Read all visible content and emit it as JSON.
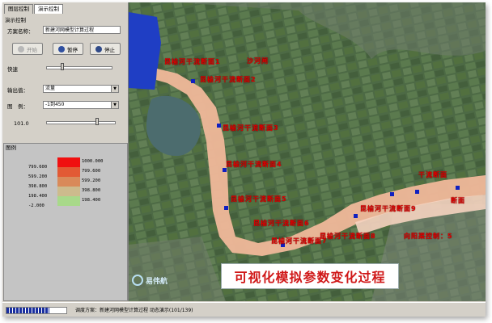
{
  "tabs": [
    "图层控制",
    "演示控制"
  ],
  "demo": {
    "group_title": "演示控制",
    "scheme_label": "方案名称：",
    "scheme_value": "新建河网模型计算过程",
    "buttons": {
      "start": "开始",
      "pause": "暂停",
      "stop": "停止"
    },
    "speed_label": "快速",
    "speed_level": 0.25,
    "output_label": "输出值：",
    "output_value": "流量",
    "legend_label": "图　例：",
    "legend_value": "-1到450",
    "value_label": "101.0",
    "value_level": 0.75
  },
  "legend": {
    "title": "图例",
    "upper_values": [
      "1000.000",
      "799.600",
      "599.200",
      "398.800",
      "198.400"
    ],
    "lower_values": [
      "799.600",
      "599.200",
      "398.800",
      "198.400",
      "-2.000"
    ],
    "colors": [
      "#f01010",
      "#e25a35",
      "#d98a5a",
      "#cdbb8d",
      "#a8d98a"
    ]
  },
  "map": {
    "section_labels": [
      "昆榆河干流断面1",
      "沙河闸",
      "昆榆河干流断面2",
      "昆榆河干流断面3",
      "昆榆河干流断面4",
      "昆榆河干流断面5",
      "昆榆河干流断面6",
      "昆榆河干流断面7",
      "昆榆河干流断面8",
      "昆榆河干流断面9",
      "向阳渠控制：5",
      "干流断面",
      "断面"
    ],
    "caption": "可视化模拟参数变化过程",
    "logo": "易伟航"
  },
  "status": {
    "progress_fraction": 0.72,
    "text": "调度方案：新建河网模型计算过程 动态演示(101/139)"
  }
}
